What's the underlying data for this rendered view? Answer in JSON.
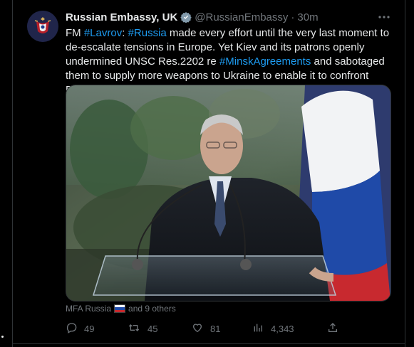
{
  "tweet": {
    "author_name": "Russian Embassy, UK",
    "handle": "@RussianEmbassy",
    "separator": "·",
    "time": "30m",
    "text_parts": [
      {
        "t": "FM ",
        "link": false
      },
      {
        "t": "#Lavrov",
        "link": true
      },
      {
        "t": ": ",
        "link": false
      },
      {
        "t": "#Russia",
        "link": true
      },
      {
        "t": " made every effort until the very last moment to de-escalate tensions in Europe. Yet Kiev and its patrons openly undermined UNSC Res.2202 re ",
        "link": false
      },
      {
        "t": "#MinskAgreements",
        "link": true
      },
      {
        "t": " and sabotaged them to supply more weapons to Ukraine to enable it to confront Russia.",
        "link": false
      }
    ]
  },
  "liked_by": {
    "account": "MFA Russia",
    "others": "and 9 others"
  },
  "actions": {
    "replies": "49",
    "retweets": "45",
    "likes": "81",
    "views": "4,343"
  },
  "icons": [
    "verified-icon",
    "more-icon",
    "reply-icon",
    "retweet-icon",
    "like-icon",
    "views-icon",
    "share-icon"
  ],
  "colors": {
    "background": "#000000",
    "text": "#e7e9ea",
    "muted": "#71767b",
    "link": "#1d9bf0",
    "border": "#2f3336"
  }
}
